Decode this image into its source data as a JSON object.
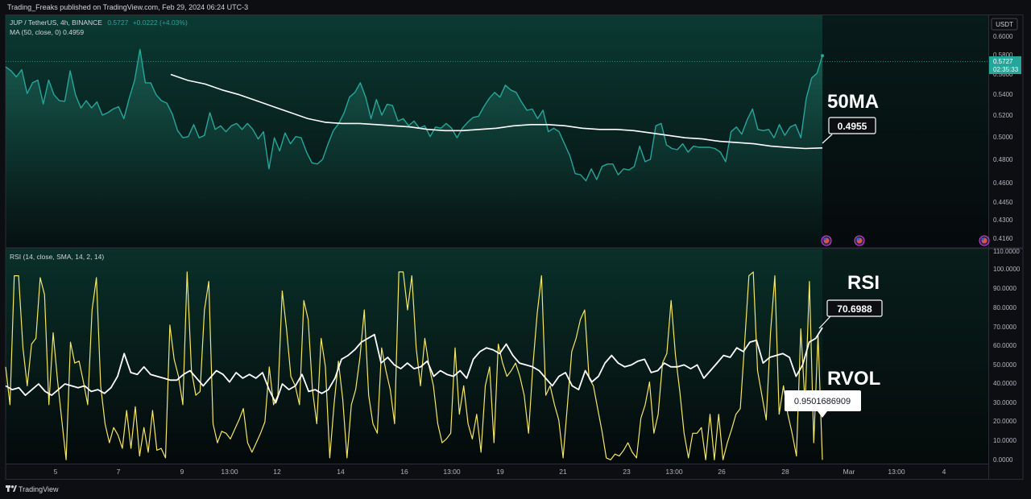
{
  "header": {
    "publish_line": "Trading_Freaks published on TradingView.com, Feb 29, 2024 06:24 UTC-3"
  },
  "price_pane": {
    "symbol_line": "JUP / TetherUS, 4h, BINANCE",
    "last_price": "0.5727",
    "change": "+0.0222 (+4.03%)",
    "ma_line": "MA (50, close, 0)  0.4959",
    "currency": "USDT",
    "price_tag": "0.5727",
    "countdown": "02:35:33",
    "ma_label": "50MA",
    "ma_value_box": "0.4955",
    "price_axis_ticks": [
      "0.6000",
      "0.5800",
      "0.5600",
      "0.5400",
      "0.5200",
      "0.5000",
      "0.4800",
      "0.4600",
      "0.4450",
      "0.4300",
      "0.4160"
    ]
  },
  "rsi_pane": {
    "title": "RSI (14, close, SMA, 14, 2, 14)",
    "rsi_label": "RSI",
    "rsi_value_box": "70.6988",
    "rvol_label": "RVOL",
    "rvol_value_box": "0.9501686909",
    "axis_ticks": [
      "110.0000",
      "100.0000",
      "90.0000",
      "80.0000",
      "70.0000",
      "60.0000",
      "50.0000",
      "40.0000",
      "30.0000",
      "20.0000",
      "10.0000",
      "0.0000"
    ]
  },
  "time_axis": {
    "labels": [
      "5",
      "7",
      "9",
      "13:00",
      "12",
      "14",
      "16",
      "13:00",
      "19",
      "21",
      "23",
      "13:00",
      "26",
      "28",
      "Mar",
      "13:00",
      "4"
    ]
  },
  "footer": {
    "brand": "TradingView"
  },
  "colors": {
    "price_line": "#26a69a",
    "ma_line": "#ffffff",
    "rsi_line": "#ffffff",
    "rvol_line": "#f5e663",
    "price_tag_bg": "#26a69a",
    "background": "#0c0e12"
  },
  "chart_data": [
    {
      "type": "area",
      "title": "JUP / TetherUS, 4h, BINANCE",
      "ylim": [
        0.4125,
        0.6065
      ],
      "series": [
        {
          "name": "JUP / TetherUS",
          "values": [
            0.5633,
            0.56,
            0.555,
            0.561,
            0.541,
            0.55,
            0.5523,
            0.5323,
            0.5523,
            0.54,
            0.535,
            0.5345,
            0.56,
            0.54,
            0.529,
            0.535,
            0.529,
            0.534,
            0.523,
            0.525,
            0.528,
            0.53,
            0.52,
            0.537,
            0.552,
            0.578,
            0.55,
            0.55,
            0.54,
            0.535,
            0.533,
            0.524,
            0.51,
            0.504,
            0.505,
            0.515,
            0.504,
            0.506,
            0.525,
            0.511,
            0.514,
            0.509,
            0.514,
            0.516,
            0.511,
            0.516,
            0.511,
            0.503,
            0.509,
            0.478,
            0.504,
            0.493,
            0.508,
            0.499,
            0.505,
            0.504,
            0.492,
            0.483,
            0.482,
            0.486,
            0.499,
            0.51,
            0.516,
            0.525,
            0.538,
            0.542,
            0.55,
            0.538,
            0.52,
            0.536,
            0.523,
            0.532,
            0.531,
            0.518,
            0.52,
            0.514,
            0.518,
            0.512,
            0.514,
            0.505,
            0.513,
            0.512,
            0.516,
            0.512,
            0.504,
            0.512,
            0.517,
            0.521,
            0.522,
            0.53,
            0.537,
            0.542,
            0.538,
            0.548,
            0.544,
            0.542,
            0.534,
            0.527,
            0.528,
            0.52,
            0.527,
            0.509,
            0.512,
            0.509,
            0.499,
            0.489,
            0.474,
            0.473,
            0.468,
            0.478,
            0.469,
            0.48,
            0.482,
            0.482,
            0.473,
            0.478,
            0.477,
            0.48,
            0.497,
            0.484,
            0.486,
            0.514,
            0.516,
            0.498,
            0.495,
            0.494,
            0.499,
            0.492,
            0.497,
            0.496,
            0.496,
            0.496,
            0.495,
            0.492,
            0.484,
            0.509,
            0.513,
            0.507,
            0.519,
            0.528,
            0.511,
            0.51,
            0.511,
            0.504,
            0.515,
            0.506,
            0.513,
            0.515,
            0.504,
            0.537,
            0.554,
            0.558,
            0.5727
          ]
        },
        {
          "name": "MA (50, close, 0)",
          "values": [
            0.557,
            0.552,
            0.549,
            0.544,
            0.54,
            0.535,
            0.53,
            0.525,
            0.52,
            0.517,
            0.516,
            0.516,
            0.515,
            0.514,
            0.513,
            0.511,
            0.51,
            0.51,
            0.511,
            0.512,
            0.514,
            0.515,
            0.515,
            0.514,
            0.512,
            0.511,
            0.511,
            0.51,
            0.508,
            0.506,
            0.504,
            0.503,
            0.501,
            0.5,
            0.499,
            0.497,
            0.4959,
            0.495,
            0.4955
          ]
        }
      ]
    },
    {
      "type": "line",
      "title": "RSI (14, close, SMA, 14, 2, 14)",
      "ylim": [
        -1,
        111
      ],
      "series": [
        {
          "name": "RSI",
          "values": [
            40,
            38,
            39,
            35,
            38,
            41,
            37,
            35,
            38,
            41,
            40,
            39,
            40,
            37,
            38,
            36,
            39,
            45,
            57,
            47,
            46,
            50,
            46,
            45,
            44,
            43,
            43,
            46,
            48,
            44,
            40,
            44,
            48,
            46,
            42,
            47,
            44,
            46,
            44,
            47,
            38,
            31,
            41,
            38,
            40,
            46,
            37,
            38,
            36,
            38,
            44,
            54,
            56,
            59,
            63,
            65,
            67,
            52,
            55,
            51,
            49,
            52,
            49,
            50,
            53,
            45,
            48,
            46,
            45,
            48,
            44,
            54,
            58,
            60,
            59,
            57,
            62,
            56,
            52,
            51,
            50,
            48,
            44,
            40,
            45,
            47,
            40,
            38,
            48,
            42,
            45,
            52,
            56,
            52,
            50,
            51,
            53,
            54,
            47,
            48,
            52,
            50,
            50,
            51,
            49,
            51,
            44,
            48,
            52,
            56,
            55,
            60,
            58,
            63,
            64,
            52,
            55,
            56,
            57,
            55,
            45,
            51,
            63,
            65,
            70.6988
          ]
        },
        {
          "name": "RVOL",
          "values": [
            50,
            30,
            98,
            98,
            60,
            40,
            62,
            65,
            97,
            88,
            30,
            68,
            43,
            22,
            1,
            63,
            52,
            53,
            42,
            30,
            80,
            97,
            40,
            20,
            10,
            18,
            14,
            7,
            27,
            7,
            29,
            3,
            18,
            5,
            27,
            6,
            7,
            2,
            72,
            54,
            45,
            30,
            100,
            48,
            35,
            37,
            80,
            95,
            20,
            10,
            16,
            15,
            12,
            17,
            22,
            28,
            10,
            5,
            10,
            15,
            21,
            50,
            30,
            35,
            90,
            70,
            45,
            40,
            30,
            85,
            75,
            38,
            20,
            65,
            50,
            2,
            30,
            53,
            33,
            2,
            30,
            38,
            55,
            80,
            35,
            20,
            15,
            60,
            48,
            38,
            20,
            100,
            100,
            80,
            98,
            60,
            40,
            65,
            50,
            40,
            20,
            10,
            12,
            15,
            60,
            25,
            40,
            20,
            12,
            25,
            5,
            40,
            50,
            10,
            62,
            52,
            45,
            48,
            52,
            45,
            35,
            15,
            50,
            78,
            98,
            35,
            40,
            30,
            22,
            2,
            30,
            58,
            65,
            75,
            80,
            44,
            40,
            28,
            16,
            2,
            1,
            4,
            3,
            6,
            10,
            5,
            2,
            23,
            30,
            42,
            15,
            25,
            52,
            57,
            85,
            56,
            37,
            15,
            2,
            15,
            15,
            18,
            1,
            25,
            1,
            25,
            1,
            10,
            17,
            25,
            28,
            62,
            98,
            100,
            48,
            35,
            22,
            68,
            98,
            25,
            40,
            25,
            15,
            3,
            70,
            30,
            95,
            10,
            67,
            0.9501686909
          ]
        }
      ]
    }
  ]
}
